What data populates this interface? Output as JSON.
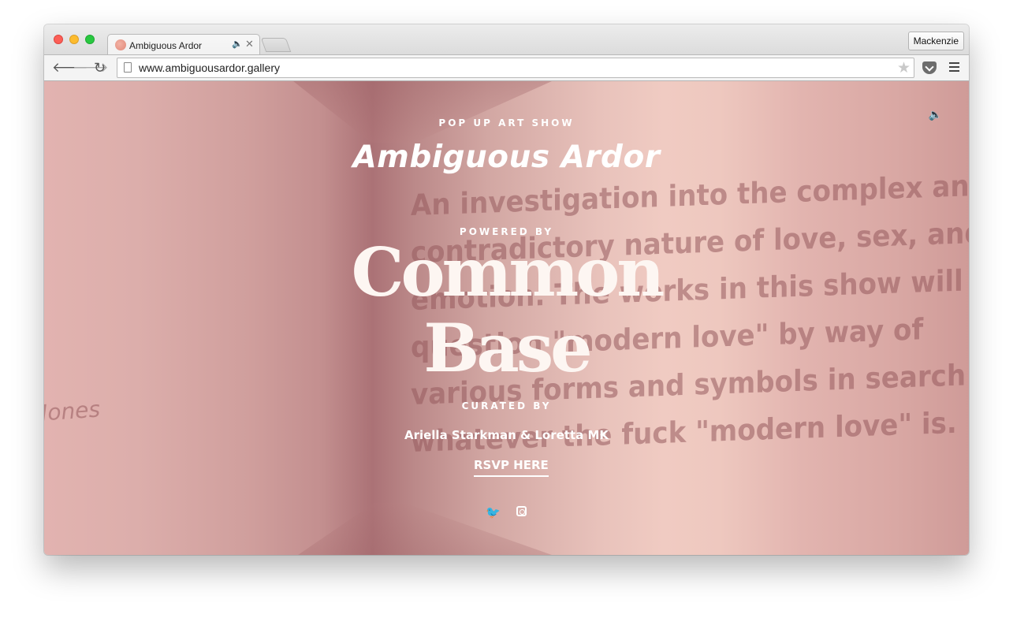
{
  "browser": {
    "tab": {
      "title": "Ambiguous Ardor",
      "audio_icon": "speaker-icon",
      "close_glyph": "✕"
    },
    "profile_name": "Mackenzie",
    "url": "www.ambiguousardor.gallery"
  },
  "page": {
    "eyebrow": "POP UP ART SHOW",
    "title": "Ambiguous Ardor",
    "powered_label": "POWERED BY",
    "brand_line1": "Common",
    "brand_line2": "Base",
    "curated_label": "CURATED BY",
    "curators": "Ariella Starkman & Loretta MK",
    "rsvp": "RSVP HERE",
    "wall_text": [
      "An investigation into the complex and",
      "contradictory nature of love, sex, and",
      "emotion. The works in this show will",
      "question \"modern love\" by way of",
      "various forms and symbols in search of",
      "whatever the fuck \"modern love\" is."
    ],
    "side_wall_text": "Jones"
  },
  "colors": {
    "wall_pink": "#e2b3b0",
    "corner_shadow": "#ab7276",
    "text_white": "#ffffff"
  }
}
